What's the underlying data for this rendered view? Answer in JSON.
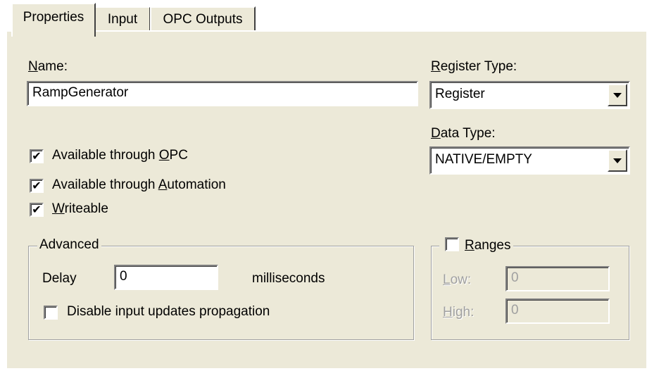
{
  "tabs": [
    {
      "label": "Properties",
      "active": true
    },
    {
      "label": "Input",
      "active": false
    },
    {
      "label": "OPC Outputs",
      "active": false
    }
  ],
  "name": {
    "label_key": "N",
    "label_rest": "ame:",
    "value": "RampGenerator"
  },
  "register_type": {
    "label_key": "R",
    "label_rest": "egister Type:",
    "value": "Register"
  },
  "data_type": {
    "label_key": "D",
    "label_rest": "ata Type:",
    "value": "NATIVE/EMPTY"
  },
  "options": [
    {
      "pre": "Available through ",
      "key": "O",
      "post": "PC",
      "checked": true
    },
    {
      "pre": "Available through ",
      "key": "A",
      "post": "utomation",
      "checked": true
    },
    {
      "pre": "",
      "key": "W",
      "post": "riteable",
      "checked": true
    }
  ],
  "advanced": {
    "title": "Advanced",
    "delay_label": "Delay",
    "delay_value": "0",
    "delay_unit": "milliseconds",
    "disable_label": "Disable input updates propagation",
    "disable_checked": false
  },
  "ranges": {
    "title_key": "R",
    "title_rest": "anges",
    "checked": false,
    "low_key": "L",
    "low_rest": "ow:",
    "low_value": "0",
    "high_key": "H",
    "high_rest": "igh:",
    "high_value": "0"
  },
  "colors": {
    "dialog_bg": "#ece9d8",
    "input_bg": "#ffffff",
    "disabled_text": "#a0a0a0"
  }
}
